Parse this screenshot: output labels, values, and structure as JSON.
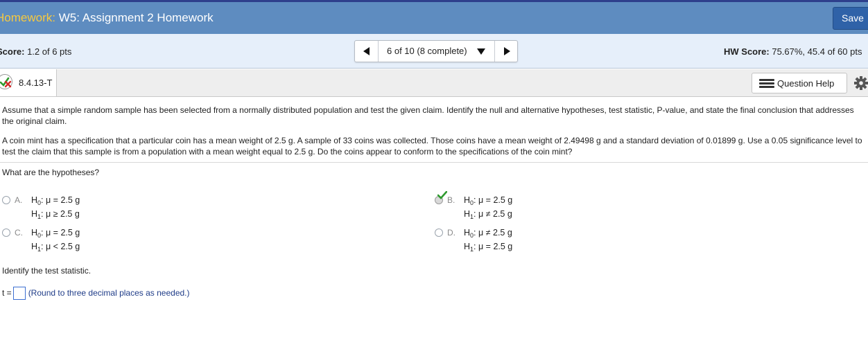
{
  "header": {
    "title_prefix": "Homework:",
    "title_rest": " W5: Assignment 2 Homework",
    "save_label": "Save"
  },
  "scorebar": {
    "score_label": "Score:",
    "score_value": " 1.2 of 6 pts",
    "question_nav": "6 of 10 (8 complete)",
    "hw_score_label": "HW Score:",
    "hw_score_value": " 75.67%, 45.4 of 60 pts"
  },
  "question": {
    "id": "8.4.13-T",
    "help_label": "Question Help",
    "instructions": "Assume that a simple random sample has been selected from a normally distributed population and test the given claim. Identify the null and alternative hypotheses, test statistic, P-value, and state the final conclusion that addresses the original claim.",
    "problem": "A coin mint has a specification that a particular coin has a mean weight of 2.5 g. A sample of 33 coins was collected. Those coins have a mean weight of 2.49498 g and a standard deviation of 0.01899 g. Use a 0.05 significance level to test the claim that this sample is from a population with a mean weight equal to 2.5 g. Do the coins appear to conform to the specifications of the coin mint?",
    "hypotheses_prompt": "What are the hypotheses?",
    "options": [
      {
        "letter": "A.",
        "h0": ": μ = 2.5 g",
        "h1": ": μ ≥ 2.5 g",
        "selected": false
      },
      {
        "letter": "B.",
        "h0": ": μ = 2.5 g",
        "h1": ": μ ≠ 2.5 g",
        "selected": true
      },
      {
        "letter": "C.",
        "h0": ": μ = 2.5 g",
        "h1": ": μ < 2.5 g",
        "selected": false
      },
      {
        "letter": "D.",
        "h0": ": μ ≠ 2.5 g",
        "h1": ": μ = 2.5 g",
        "selected": false
      }
    ],
    "h0_label": "H",
    "h0_sub": "0",
    "h1_label": "H",
    "h1_sub": "1",
    "test_stat_prompt": "Identify the test statistic.",
    "t_label": "t =",
    "t_value": "",
    "t_hint": "(Round to three decimal places as needed.)"
  },
  "colors": {
    "header_bg": "#5e8cc0",
    "header_accent": "#f7c93f",
    "save_bg": "#2f62a8",
    "scorebar_bg": "#e6effa",
    "correct_check": "#2e9a2e",
    "wrong_x": "#d22a2a"
  },
  "icons": [
    "status-partial-icon",
    "prev-arrow-icon",
    "dropdown-caret-icon",
    "next-arrow-icon",
    "list-icon",
    "gear-icon",
    "checkmark-icon"
  ]
}
